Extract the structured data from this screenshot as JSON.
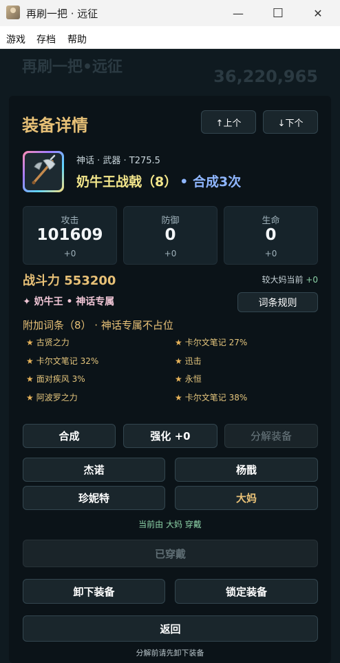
{
  "window": {
    "title": "再刷一把 · 远征",
    "minimize": "—",
    "maximize": "☐",
    "close": "✕"
  },
  "menu": {
    "items": [
      "游戏",
      "存档",
      "帮助"
    ]
  },
  "background": {
    "title": "再刷一把•远征",
    "total_number": "36,220,965"
  },
  "modal": {
    "heading": "装备详情",
    "prev_label": "↑上个",
    "next_label": "↓下个",
    "item": {
      "meta": "神话 · 武器 · T275.5",
      "name": "奶牛王战戟（8）",
      "synth": "• 合成3次",
      "name_color": "#f3e68b",
      "synth_color": "#8fb6ff",
      "icon": "battle-axe-icon"
    },
    "stats": [
      {
        "label": "攻击",
        "value": "101609",
        "delta": "+0"
      },
      {
        "label": "防御",
        "value": "0",
        "delta": "+0"
      },
      {
        "label": "生命",
        "value": "0",
        "delta": "+0"
      }
    ],
    "power": "战斗力 553200",
    "compare_label": "较大妈当前",
    "compare_delta": "+0",
    "set_name": "✦ 奶牛王 • 神话专属",
    "rules_button": "词条规则",
    "affix_title": "附加词条（8） · 神话专属不占位",
    "affixes": [
      "古贤之力",
      "卡尔文笔记 27%",
      "卡尔文笔记 32%",
      "迅击",
      "面对疾风 3%",
      "永恒",
      "阿波罗之力",
      "卡尔文笔记 38%"
    ],
    "actions": {
      "synth": "合成",
      "enhance": "强化 +0",
      "decompose": "分解装备"
    },
    "heroes": [
      "杰诺",
      "杨戬",
      "珍妮特",
      "大妈"
    ],
    "wearing_text": "当前由 大妈 穿戴",
    "worn_button": "已穿戴",
    "unequip_button": "卸下装备",
    "lock_button": "锁定装备",
    "back_button": "返回",
    "footnote": "分解前请先卸下装备"
  }
}
